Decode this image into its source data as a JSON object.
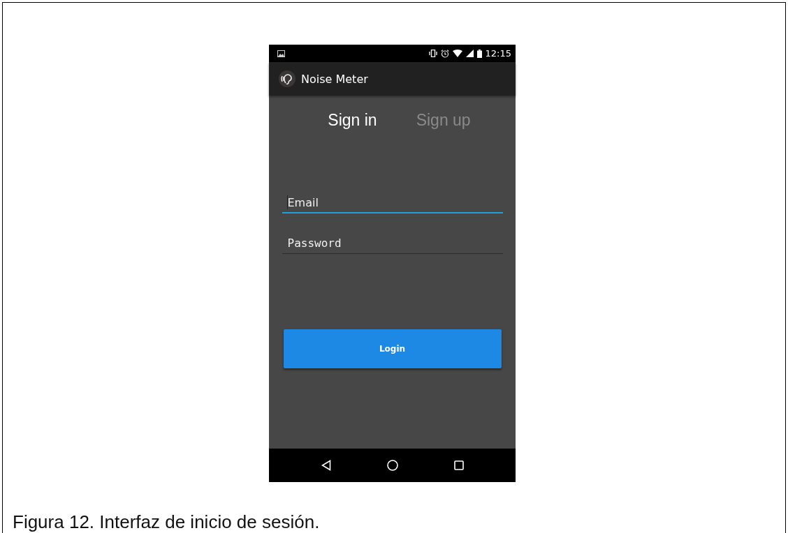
{
  "status_bar": {
    "time": "12:15"
  },
  "app_bar": {
    "title": "Noise Meter"
  },
  "tabs": [
    {
      "label": "Sign in",
      "selected": true
    },
    {
      "label": "Sign up",
      "selected": false
    }
  ],
  "fields": [
    {
      "placeholder": "Email",
      "focused": true
    },
    {
      "placeholder": "Password",
      "focused": false
    }
  ],
  "login_button": {
    "label": "Login"
  },
  "caption": "Figura 12. Interfaz de inicio de sesión."
}
